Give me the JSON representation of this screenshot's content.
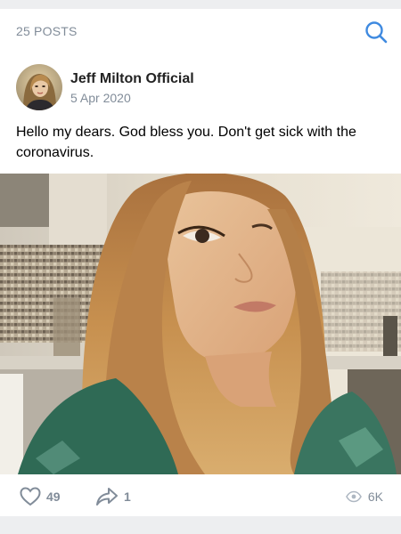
{
  "header": {
    "posts_count": "25 POSTS",
    "search_icon": "search-icon"
  },
  "post": {
    "author": {
      "name": "Jeff Milton Official",
      "avatar_icon": "avatar"
    },
    "date": "5 Apr 2020",
    "text": "Hello my dears. God bless you. Don't get sick with the coronavirus.",
    "photo": "selfie-photo",
    "actions": {
      "likes": "49",
      "shares": "1",
      "views": "6K"
    }
  },
  "colors": {
    "accent": "#3f8ae0",
    "secondary_text": "#818c99",
    "background": "#edeef0"
  }
}
